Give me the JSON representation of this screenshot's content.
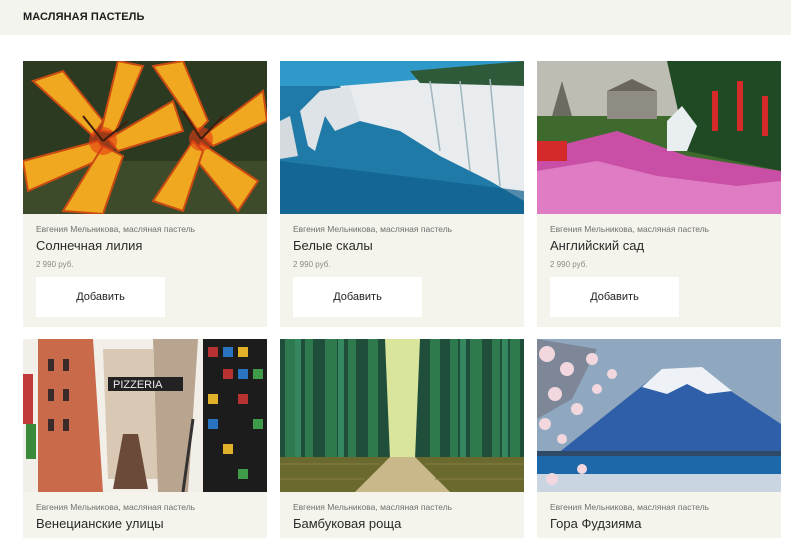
{
  "header": {
    "title": "МАСЛЯНАЯ ПАСТЕЛЬ"
  },
  "products": [
    {
      "author": "Евгения Мельникова, масляная пастель",
      "name": "Солнечная лилия",
      "price": "2 990 руб.",
      "button": "Добавить",
      "image": "lily-painting"
    },
    {
      "author": "Евгения Мельникова, масляная пастель",
      "name": "Белые скалы",
      "price": "2 990 руб.",
      "button": "Добавить",
      "image": "white-cliffs-painting"
    },
    {
      "author": "Евгения Мельникова, масляная пастель",
      "name": "Английский сад",
      "price": "2 990 руб.",
      "button": "Добавить",
      "image": "english-garden-painting"
    },
    {
      "author": "Евгения Мельникова, масляная пастель",
      "name": "Венецианские улицы",
      "image": "venice-streets-painting"
    },
    {
      "author": "Евгения Мельникова, масляная пастель",
      "name": "Бамбуковая роща",
      "image": "bamboo-grove-painting"
    },
    {
      "author": "Евгения Мельникова, масляная пастель",
      "name": "Гора Фудзияма",
      "image": "mount-fuji-painting"
    }
  ]
}
